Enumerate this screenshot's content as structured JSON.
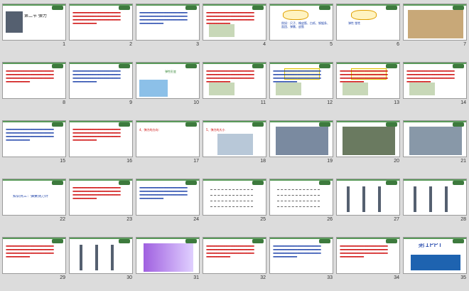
{
  "slides": [
    {
      "n": "1",
      "title": "第二节 弹力"
    },
    {
      "n": "2"
    },
    {
      "n": "3"
    },
    {
      "n": "4"
    },
    {
      "n": "5"
    },
    {
      "n": "6"
    },
    {
      "n": "7"
    },
    {
      "n": "8"
    },
    {
      "n": "9"
    },
    {
      "n": "10"
    },
    {
      "n": "11"
    },
    {
      "n": "12"
    },
    {
      "n": "13"
    },
    {
      "n": "14"
    },
    {
      "n": "15"
    },
    {
      "n": "16"
    },
    {
      "n": "17"
    },
    {
      "n": "18"
    },
    {
      "n": "19"
    },
    {
      "n": "20"
    },
    {
      "n": "21"
    },
    {
      "n": "22",
      "title": "知识点三：弹簧测力计"
    },
    {
      "n": "23"
    },
    {
      "n": "24"
    },
    {
      "n": "25"
    },
    {
      "n": "26"
    },
    {
      "n": "27"
    },
    {
      "n": "28"
    },
    {
      "n": "29"
    },
    {
      "n": "30"
    },
    {
      "n": "31"
    },
    {
      "n": "32"
    },
    {
      "n": "33"
    },
    {
      "n": "34"
    },
    {
      "n": "35",
      "title": "第1PPT"
    }
  ],
  "texts": {
    "s5": "例如：尺子、橡皮筋、白纸、钢锯条、面团、弹簧、皮筋",
    "s6": "弹性 塑性",
    "s10": "弹性形变",
    "s17": "4、弹力的方向：",
    "s18": "5、弹力的大小"
  }
}
